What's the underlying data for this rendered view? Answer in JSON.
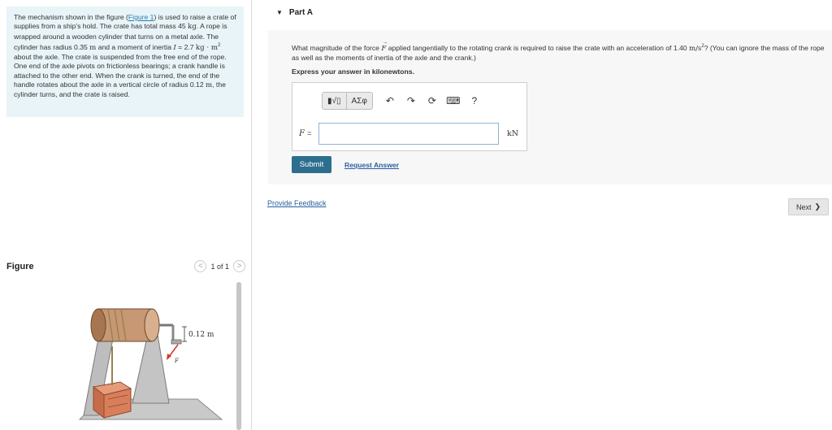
{
  "problem": {
    "p1": "The mechanism shown in the figure (",
    "figure_link": "Figure 1",
    "p2": ") is used to raise a crate of supplies from a ship's hold. The crate has total mass 45 ",
    "kg1": "kg",
    "p3": ". A rope is wrapped around a wooden cylinder that turns on a metal axle. The cylinder has radius 0.35 ",
    "m1": "m",
    "p4": " and a moment of inertia ",
    "I_sym": "I",
    "p5": " = 2.7 ",
    "kgm2": "kg · m",
    "sq": "2",
    "p6": " about the axle. The crate is suspended from the free end of the rope. One end of the axle pivots on frictionless bearings; a crank handle is attached to the other end. When the crank is turned, the end of the handle rotates about the axle in a vertical circle of radius 0.12 ",
    "m2": "m",
    "p7": ", the cylinder turns, and the crate is raised."
  },
  "figure_panel": {
    "title": "Figure",
    "pager_prev": "<",
    "pager_text": "1 of 1",
    "pager_next": ">",
    "dim_label": "0.12 m",
    "force_label": "F"
  },
  "part": {
    "caret": "▼",
    "title": "Part A",
    "q1": "What magnitude of the force ",
    "F_sym": "F",
    "arrow": "→",
    "q2": " applied tangentially to the rotating crank is required to raise the crate with an acceleration of 1.40 ",
    "acc_unit": "m/s",
    "acc_sq": "2",
    "q3": "? (You can ignore the mass of the rope as well as the moments of inertia of the axle and the crank.)",
    "instruction": "Express your answer in kilonewtons."
  },
  "toolbar": {
    "templates_label": "▮√▯",
    "symbols_label": "ΑΣφ",
    "undo": "↶",
    "redo": "↷",
    "reset": "⟳",
    "keyboard": "⌨",
    "help": "?"
  },
  "answer": {
    "variable": "F",
    "equals": "=",
    "value": "",
    "unit": "kN"
  },
  "actions": {
    "submit": "Submit",
    "request": "Request Answer"
  },
  "footer": {
    "feedback": "Provide Feedback",
    "next": "Next",
    "next_icon": "❯"
  }
}
